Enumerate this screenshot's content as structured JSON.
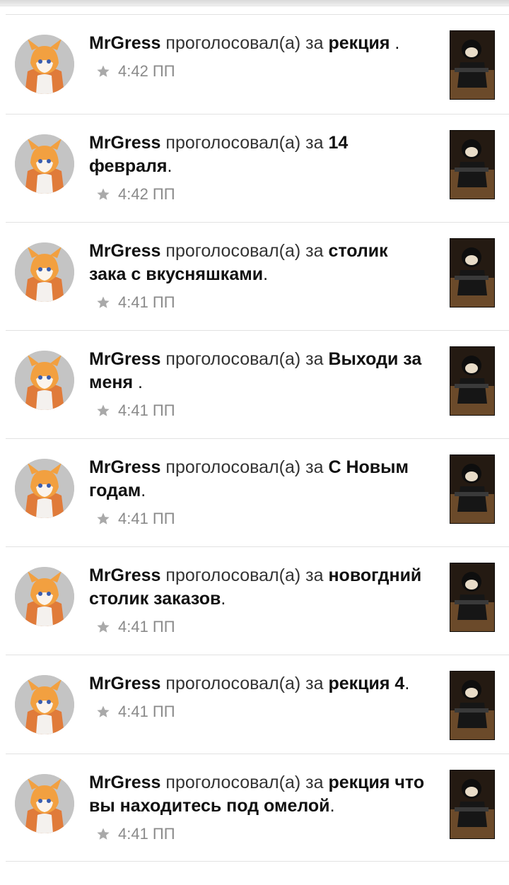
{
  "feed": {
    "items": [
      {
        "user": "MrGress",
        "action": "проголосовал(а) за",
        "target": "рекция",
        "end": " .",
        "time": "4:42 ПП"
      },
      {
        "user": "MrGress",
        "action": "проголосовал(а) за",
        "target": "14 февраля",
        "end": ".",
        "time": "4:42 ПП"
      },
      {
        "user": "MrGress",
        "action": "проголосовал(а) за",
        "target": "столик зака с вкусняшками",
        "end": ".",
        "time": "4:41 ПП"
      },
      {
        "user": "MrGress",
        "action": "проголосовал(а) за",
        "target": "Выходи за меня",
        "end": " .",
        "time": "4:41 ПП"
      },
      {
        "user": "MrGress",
        "action": "проголосовал(а) за",
        "target": "С Новым годам",
        "end": ".",
        "time": "4:41 ПП"
      },
      {
        "user": "MrGress",
        "action": "проголосовал(а) за",
        "target": "новогдний столик заказов",
        "end": ".",
        "time": "4:41 ПП"
      },
      {
        "user": "MrGress",
        "action": "проголосовал(а) за",
        "target": "рекция 4",
        "end": ".",
        "time": "4:41 ПП"
      },
      {
        "user": "MrGress",
        "action": "проголосовал(а) за",
        "target": "рекция что вы находитесь под омелой",
        "end": ".",
        "time": "4:41 ПП"
      }
    ],
    "icons": {
      "vote": "star-icon",
      "avatar": "fox-avatar",
      "post": "post-thumbnail"
    },
    "colors": {
      "text": "#111111",
      "meta": "#8a8a8a",
      "divider": "#e2e2e2"
    }
  }
}
